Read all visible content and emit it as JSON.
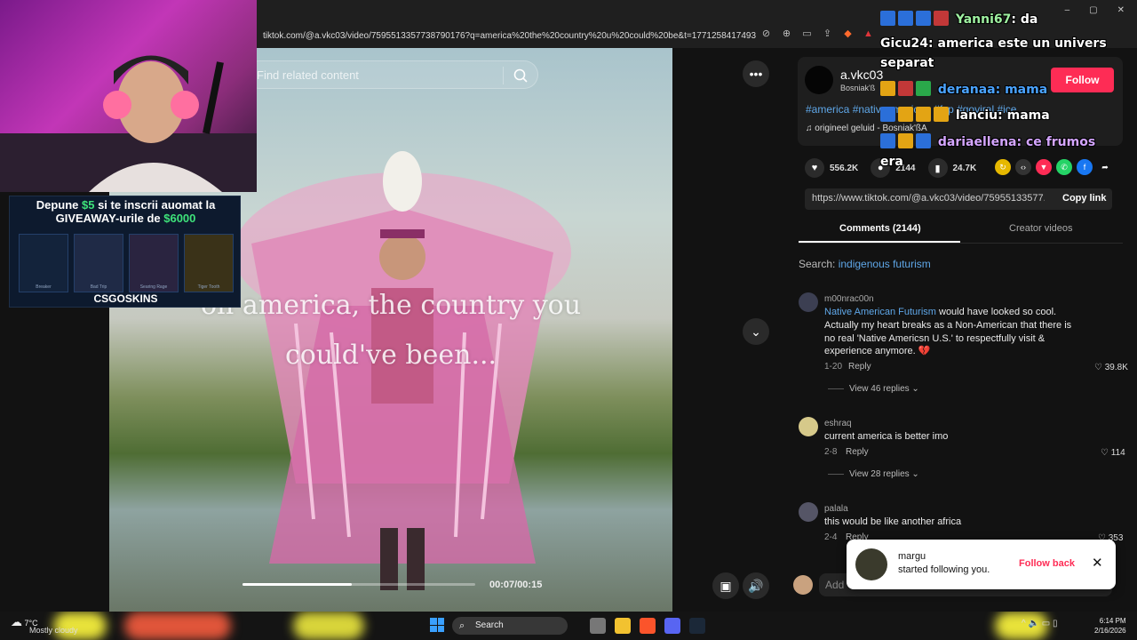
{
  "browser": {
    "url": "tiktok.com/@a.vkc03/video/7595513357738790176?q=america%20the%20country%20u%20could%20be&t=1771258417493",
    "window_controls": [
      "–",
      "▢",
      "✕"
    ]
  },
  "video": {
    "search_placeholder": "Find related content",
    "overlay_line1": "oh america, the country you",
    "overlay_line2": "could've been...",
    "time": "00:07/00:15",
    "progress": 0.47
  },
  "ad": {
    "line1_a": "Depune ",
    "line1_amount": "$5",
    "line1_b": " si te inscrii auomat la",
    "line2_a": "GIVEAWAY-urile de ",
    "line2_amount": "$6000",
    "skins": [
      "Breaker",
      "Bad Trip",
      "Searing Rage",
      "Tiger Tooth"
    ],
    "brand": "CSGOSKINS"
  },
  "author": {
    "name": "a.vkc03",
    "nickname": "Bosniak'ß",
    "follow_label": "Follow",
    "tags": "#america #nativeamerican #fyp #goviral #ice",
    "music": "origineel geluid - Bosniak'ßA"
  },
  "stats": {
    "likes": "556.2K",
    "comments": "2144",
    "saves": "24.7K"
  },
  "share": {
    "link": "https://www.tiktok.com/@a.vkc03/video/75955133577...",
    "copy_label": "Copy link"
  },
  "tabs": {
    "comments": "Comments (2144)",
    "creator": "Creator videos"
  },
  "search": {
    "prefix": "Search: ",
    "keyword": "indigenous futurism"
  },
  "comments": [
    {
      "user": "m00nrac00n",
      "link": "Native American Futurism",
      "line1": " would have looked so cool.",
      "line2": "Actually my heart breaks as a Non-American that there is",
      "line3": "no real 'Native Americsn U.S.' to respectfully visit &",
      "line4": "experience anymore. 💔",
      "date": "1-20",
      "reply": "Reply",
      "likes": "39.8K",
      "replies": "View 46 replies"
    },
    {
      "user": "eshraq",
      "text": "current america is better imo",
      "date": "2-8",
      "reply": "Reply",
      "likes": "114",
      "replies": "View 28 replies"
    },
    {
      "user": "palala",
      "text": "this would be like another africa",
      "date": "2-4",
      "reply": "Reply",
      "likes": "353"
    }
  ],
  "comment_input_placeholder": "Add",
  "toast": {
    "user": "margu",
    "message": "started following you.",
    "action": "Follow back"
  },
  "chat": [
    {
      "user": "Yanni67",
      "text": " da",
      "color": "#ffffff"
    },
    {
      "user": "Gicu24",
      "text": " america este un univers",
      "color": "#ffffff"
    },
    {
      "user": "",
      "text": "separat",
      "color": "#ffffff"
    },
    {
      "user": "deranaa",
      "text": " mama",
      "color": "#4aa3ff"
    },
    {
      "user": "lanciu",
      "text": " mama",
      "color": "#ffffff"
    },
    {
      "user": "dariaellena",
      "text": " ce frumos",
      "color": "#d4a5ff"
    },
    {
      "user": "",
      "text": "era",
      "color": "#ffffff"
    }
  ],
  "taskbar": {
    "temp": "7°C",
    "weather": "Mostly cloudy",
    "search": "Search",
    "time": "6:14 PM",
    "date": "2/16/2026"
  }
}
